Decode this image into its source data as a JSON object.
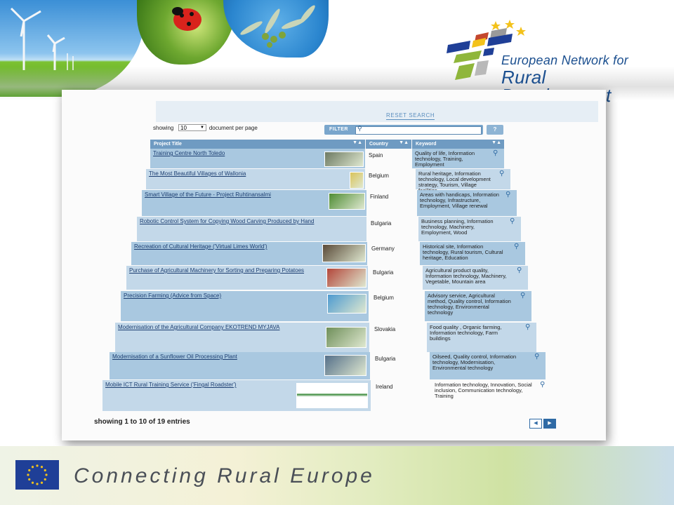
{
  "logo": {
    "line1": "European Network for",
    "line2": "Rural Development"
  },
  "toolbar": {
    "reset_label": "RESET SEARCH",
    "showing_prefix": "showing",
    "per_page_value": "10",
    "per_page_suffix": "document per page",
    "filter_label": "FILTER",
    "help_label": "?"
  },
  "table": {
    "headers": [
      "Project Title",
      "Country",
      "Keyword"
    ],
    "rows": [
      {
        "title": "Training Centre North Toledo",
        "country": "Spain",
        "keywords": "Quality of life, Information technology, Training, Employment"
      },
      {
        "title": "The Most Beautiful Villages of Wallonia",
        "country": "Belgium",
        "keywords": "Rural heritage, Information technology, Local development strategy, Tourism, Village facilities"
      },
      {
        "title": "Smart Village of the Future - Project Ruhtinansalmi",
        "country": "Finland",
        "keywords": "Areas with handicaps, Information technology, Infrastructure, Employment, Village renewal"
      },
      {
        "title": "Robotic Control System for Copying Wood Carving Produced by Hand",
        "country": "Bulgaria",
        "keywords": "Business planning, Information technology, Machinery, Employment, Wood"
      },
      {
        "title": "Recreation of Cultural Heritage ('Virtual Limes World')",
        "country": "Germany",
        "keywords": "Historical site, Information technology, Rural tourism, Cultural heritage, Education"
      },
      {
        "title": "Purchase of Agricultural Machinery for Sorting and Preparing Potatoes",
        "country": "Bulgaria",
        "keywords": "Agricultural product quality, Information technology, Machinery, Vegetable, Mountain area"
      },
      {
        "title": "Precision Farming (Advice from Space)",
        "country": "Belgium",
        "keywords": "Advisory service, Agricultural method, Quality control, Information technology, Environmental technology"
      },
      {
        "title": "Modernisation of the Agricultural Company EKOTREND MYJAVA",
        "country": "Slovakia",
        "keywords": "Food quality , Organic farming, Information technology, Farm buildings"
      },
      {
        "title": "Modernisation of a Sunflower Oil Processing Plant",
        "country": "Bulgaria",
        "keywords": "Oilseed, Quality control, Information technology, Modernisation, Environmental technology"
      },
      {
        "title": "Mobile ICT Rural Training Service ('Fingal Roadster')",
        "country": "Ireland",
        "keywords": "Information technology, Innovation, Social inclusion, Communication technology, Training"
      }
    ],
    "footer_count": "showing 1 to 10 of 19 entries"
  },
  "footer": {
    "tagline": "Connecting Rural Europe"
  },
  "colors": {
    "header_blue": "#6f9bc2",
    "row_blue": "#a9c8e0",
    "brand_blue": "#1b4f8f"
  }
}
